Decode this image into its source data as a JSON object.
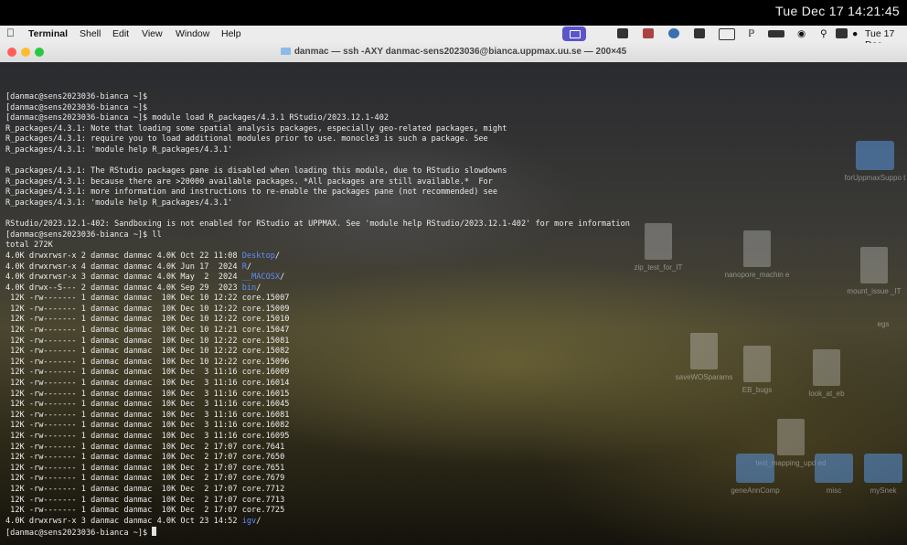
{
  "clock": "Tue Dec 17  14:21:45",
  "menubar": {
    "apple_icon": "apple-icon",
    "app_name": "Terminal",
    "items": [
      "Shell",
      "Edit",
      "View",
      "Window",
      "Help"
    ],
    "right_date": "Tue 17 Dec",
    "tray_icons": [
      "screen-mirror-icon",
      "contacts-icon",
      "camera-icon",
      "ubuntu-icon",
      "shield-icon",
      "se-icon",
      "bluetooth-icon",
      "battery-icon",
      "wifi-icon",
      "search-icon",
      "control-center-icon",
      "siri-icon"
    ]
  },
  "window": {
    "title": "danmac — ssh -AXY danmac-sens2023036@bianca.uppmax.uu.se — 200×45"
  },
  "desktop_icons": [
    {
      "label": "zip_test_for_IT"
    },
    {
      "label": "nanopore_machin e"
    },
    {
      "label": "forUppmaxSuppo t"
    },
    {
      "label": "mount_issue _IT"
    },
    {
      "label": "egs"
    },
    {
      "label": "saveWOSparams"
    },
    {
      "label": "EB_bugs"
    },
    {
      "label": "look_at_eb"
    },
    {
      "label": "test_mapping_upd ed"
    },
    {
      "label": "geneAnnComp"
    },
    {
      "label": "misc"
    },
    {
      "label": "mySnek"
    }
  ],
  "terminal": {
    "lines": [
      {
        "text": "[danmac@sens2023036-bianca ~]$"
      },
      {
        "text": "[danmac@sens2023036-bianca ~]$"
      },
      {
        "text": "[danmac@sens2023036-bianca ~]$ module load R_packages/4.3.1 RStudio/2023.12.1-402"
      },
      {
        "text": "R_packages/4.3.1: Note that loading some spatial analysis packages, especially geo-related packages, might"
      },
      {
        "text": "R_packages/4.3.1: require you to load additional modules prior to use. monocle3 is such a package. See"
      },
      {
        "text": "R_packages/4.3.1: 'module help R_packages/4.3.1'"
      },
      {
        "text": ""
      },
      {
        "text": "R_packages/4.3.1: The RStudio packages pane is disabled when loading this module, due to RStudio slowdowns"
      },
      {
        "text": "R_packages/4.3.1: because there are >20000 available packages. *All packages are still available.*  For"
      },
      {
        "text": "R_packages/4.3.1: more information and instructions to re-enable the packages pane (not recommended) see"
      },
      {
        "text": "R_packages/4.3.1: 'module help R_packages/4.3.1'"
      },
      {
        "text": ""
      },
      {
        "text": "RStudio/2023.12.1-402: Sandboxing is not enabled for RStudio at UPPMAX. See 'module help RStudio/2023.12.1-402' for more information"
      },
      {
        "text": "[danmac@sens2023036-bianca ~]$ ll"
      },
      {
        "text": "total 272K"
      },
      {
        "text": "4.0K drwxrwsr-x 2 danmac danmac 4.0K Oct 22 11:08 ",
        "dir": "Desktop",
        "suffix": "/"
      },
      {
        "text": "4.0K drwxrwsr-x 4 danmac danmac 4.0K Jun 17  2024 ",
        "dir": "R",
        "suffix": "/"
      },
      {
        "text": "4.0K drwxrwsr-x 3 danmac danmac 4.0K May  2  2024 ",
        "dir": "__MACOSX",
        "suffix": "/"
      },
      {
        "text": "4.0K drwx--S--- 2 danmac danmac 4.0K Sep 29  2023 ",
        "dir": "bin",
        "suffix": "/"
      },
      {
        "text": " 12K -rw------- 1 danmac danmac  10K Dec 10 12:22 core.15007"
      },
      {
        "text": " 12K -rw------- 1 danmac danmac  10K Dec 10 12:22 core.15009"
      },
      {
        "text": " 12K -rw------- 1 danmac danmac  10K Dec 10 12:22 core.15010"
      },
      {
        "text": " 12K -rw------- 1 danmac danmac  10K Dec 10 12:21 core.15047"
      },
      {
        "text": " 12K -rw------- 1 danmac danmac  10K Dec 10 12:22 core.15081"
      },
      {
        "text": " 12K -rw------- 1 danmac danmac  10K Dec 10 12:22 core.15082"
      },
      {
        "text": " 12K -rw------- 1 danmac danmac  10K Dec 10 12:22 core.15096"
      },
      {
        "text": " 12K -rw------- 1 danmac danmac  10K Dec  3 11:16 core.16009"
      },
      {
        "text": " 12K -rw------- 1 danmac danmac  10K Dec  3 11:16 core.16014"
      },
      {
        "text": " 12K -rw------- 1 danmac danmac  10K Dec  3 11:16 core.16015"
      },
      {
        "text": " 12K -rw------- 1 danmac danmac  10K Dec  3 11:16 core.16045"
      },
      {
        "text": " 12K -rw------- 1 danmac danmac  10K Dec  3 11:16 core.16081"
      },
      {
        "text": " 12K -rw------- 1 danmac danmac  10K Dec  3 11:16 core.16082"
      },
      {
        "text": " 12K -rw------- 1 danmac danmac  10K Dec  3 11:16 core.16095"
      },
      {
        "text": " 12K -rw------- 1 danmac danmac  10K Dec  2 17:07 core.7641"
      },
      {
        "text": " 12K -rw------- 1 danmac danmac  10K Dec  2 17:07 core.7650"
      },
      {
        "text": " 12K -rw------- 1 danmac danmac  10K Dec  2 17:07 core.7651"
      },
      {
        "text": " 12K -rw------- 1 danmac danmac  10K Dec  2 17:07 core.7679"
      },
      {
        "text": " 12K -rw------- 1 danmac danmac  10K Dec  2 17:07 core.7712"
      },
      {
        "text": " 12K -rw------- 1 danmac danmac  10K Dec  2 17:07 core.7713"
      },
      {
        "text": " 12K -rw------- 1 danmac danmac  10K Dec  2 17:07 core.7725"
      },
      {
        "text": "4.0K drwxrwsr-x 3 danmac danmac 4.0K Oct 23 14:52 ",
        "dir": "igv",
        "suffix": "/"
      },
      {
        "text": "[danmac@sens2023036-bianca ~]$ ",
        "cursor": true
      }
    ]
  }
}
